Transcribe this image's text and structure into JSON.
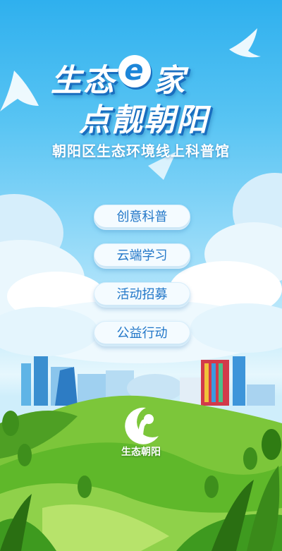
{
  "header": {
    "title_line1_part1": "生态",
    "title_badge": "e",
    "title_line1_part2": "家",
    "title_line2": "点靓朝阳",
    "subtitle": "朝阳区生态环境线上科普馆"
  },
  "menu": {
    "items": [
      {
        "label": "创意科普"
      },
      {
        "label": "云端学习"
      },
      {
        "label": "活动招募"
      },
      {
        "label": "公益行动"
      }
    ]
  },
  "footer": {
    "logo_text": "生态朝阳"
  },
  "colors": {
    "sky_top": "#2fb0ee",
    "button_text": "#2277c8",
    "hill_green": "#5fb82a"
  }
}
